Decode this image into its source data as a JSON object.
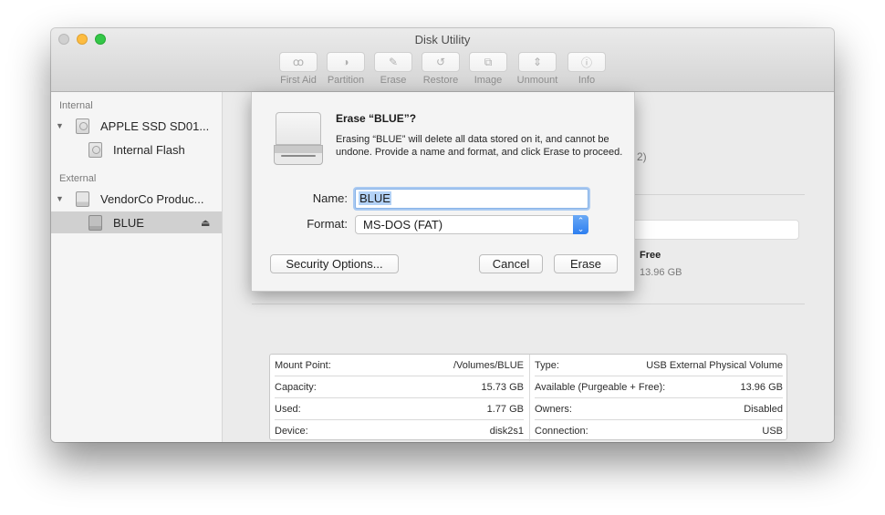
{
  "window": {
    "title": "Disk Utility"
  },
  "toolbar": {
    "items": [
      {
        "label": "First Aid",
        "icon": "stethoscope-icon",
        "glyph": "ꝏ"
      },
      {
        "label": "Partition",
        "icon": "partition-pie-icon",
        "glyph": "◑"
      },
      {
        "label": "Erase",
        "icon": "erase-icon",
        "glyph": "✎"
      },
      {
        "label": "Restore",
        "icon": "restore-icon",
        "glyph": "↺"
      },
      {
        "label": "Image",
        "icon": "image-icon",
        "glyph": "⧉"
      },
      {
        "label": "Unmount",
        "icon": "unmount-icon",
        "glyph": "⇕"
      },
      {
        "label": "Info",
        "icon": "info-icon",
        "glyph": "ⓘ"
      }
    ]
  },
  "sidebar": {
    "internal_header": "Internal",
    "external_header": "External",
    "items": [
      {
        "label": "APPLE SSD SD01...",
        "type": "internal-disk"
      },
      {
        "label": "Internal Flash",
        "type": "internal-volume"
      },
      {
        "label": "VendorCo Produc...",
        "type": "external-disk"
      },
      {
        "label": "BLUE",
        "type": "external-volume",
        "selected": true
      }
    ],
    "disclosure_glyph": "▼",
    "eject_glyph": "⏏"
  },
  "content": {
    "partial_subtitle": "2)",
    "free_label": "Free",
    "free_value": "13.96 GB",
    "info_left": [
      {
        "label": "Mount Point:",
        "value": "/Volumes/BLUE"
      },
      {
        "label": "Capacity:",
        "value": "15.73 GB"
      },
      {
        "label": "Used:",
        "value": "1.77 GB"
      },
      {
        "label": "Device:",
        "value": "disk2s1"
      }
    ],
    "info_right": [
      {
        "label": "Type:",
        "value": "USB External Physical Volume"
      },
      {
        "label": "Available (Purgeable + Free):",
        "value": "13.96 GB"
      },
      {
        "label": "Owners:",
        "value": "Disabled"
      },
      {
        "label": "Connection:",
        "value": "USB"
      }
    ]
  },
  "sheet": {
    "title": "Erase “BLUE”?",
    "message": "Erasing “BLUE” will delete all data stored on it, and cannot be undone. Provide a name and format, and click Erase to proceed.",
    "name_label": "Name:",
    "name_value": "BLUE",
    "format_label": "Format:",
    "format_value": "MS-DOS (FAT)",
    "security_button": "Security Options...",
    "cancel_button": "Cancel",
    "erase_button": "Erase"
  }
}
